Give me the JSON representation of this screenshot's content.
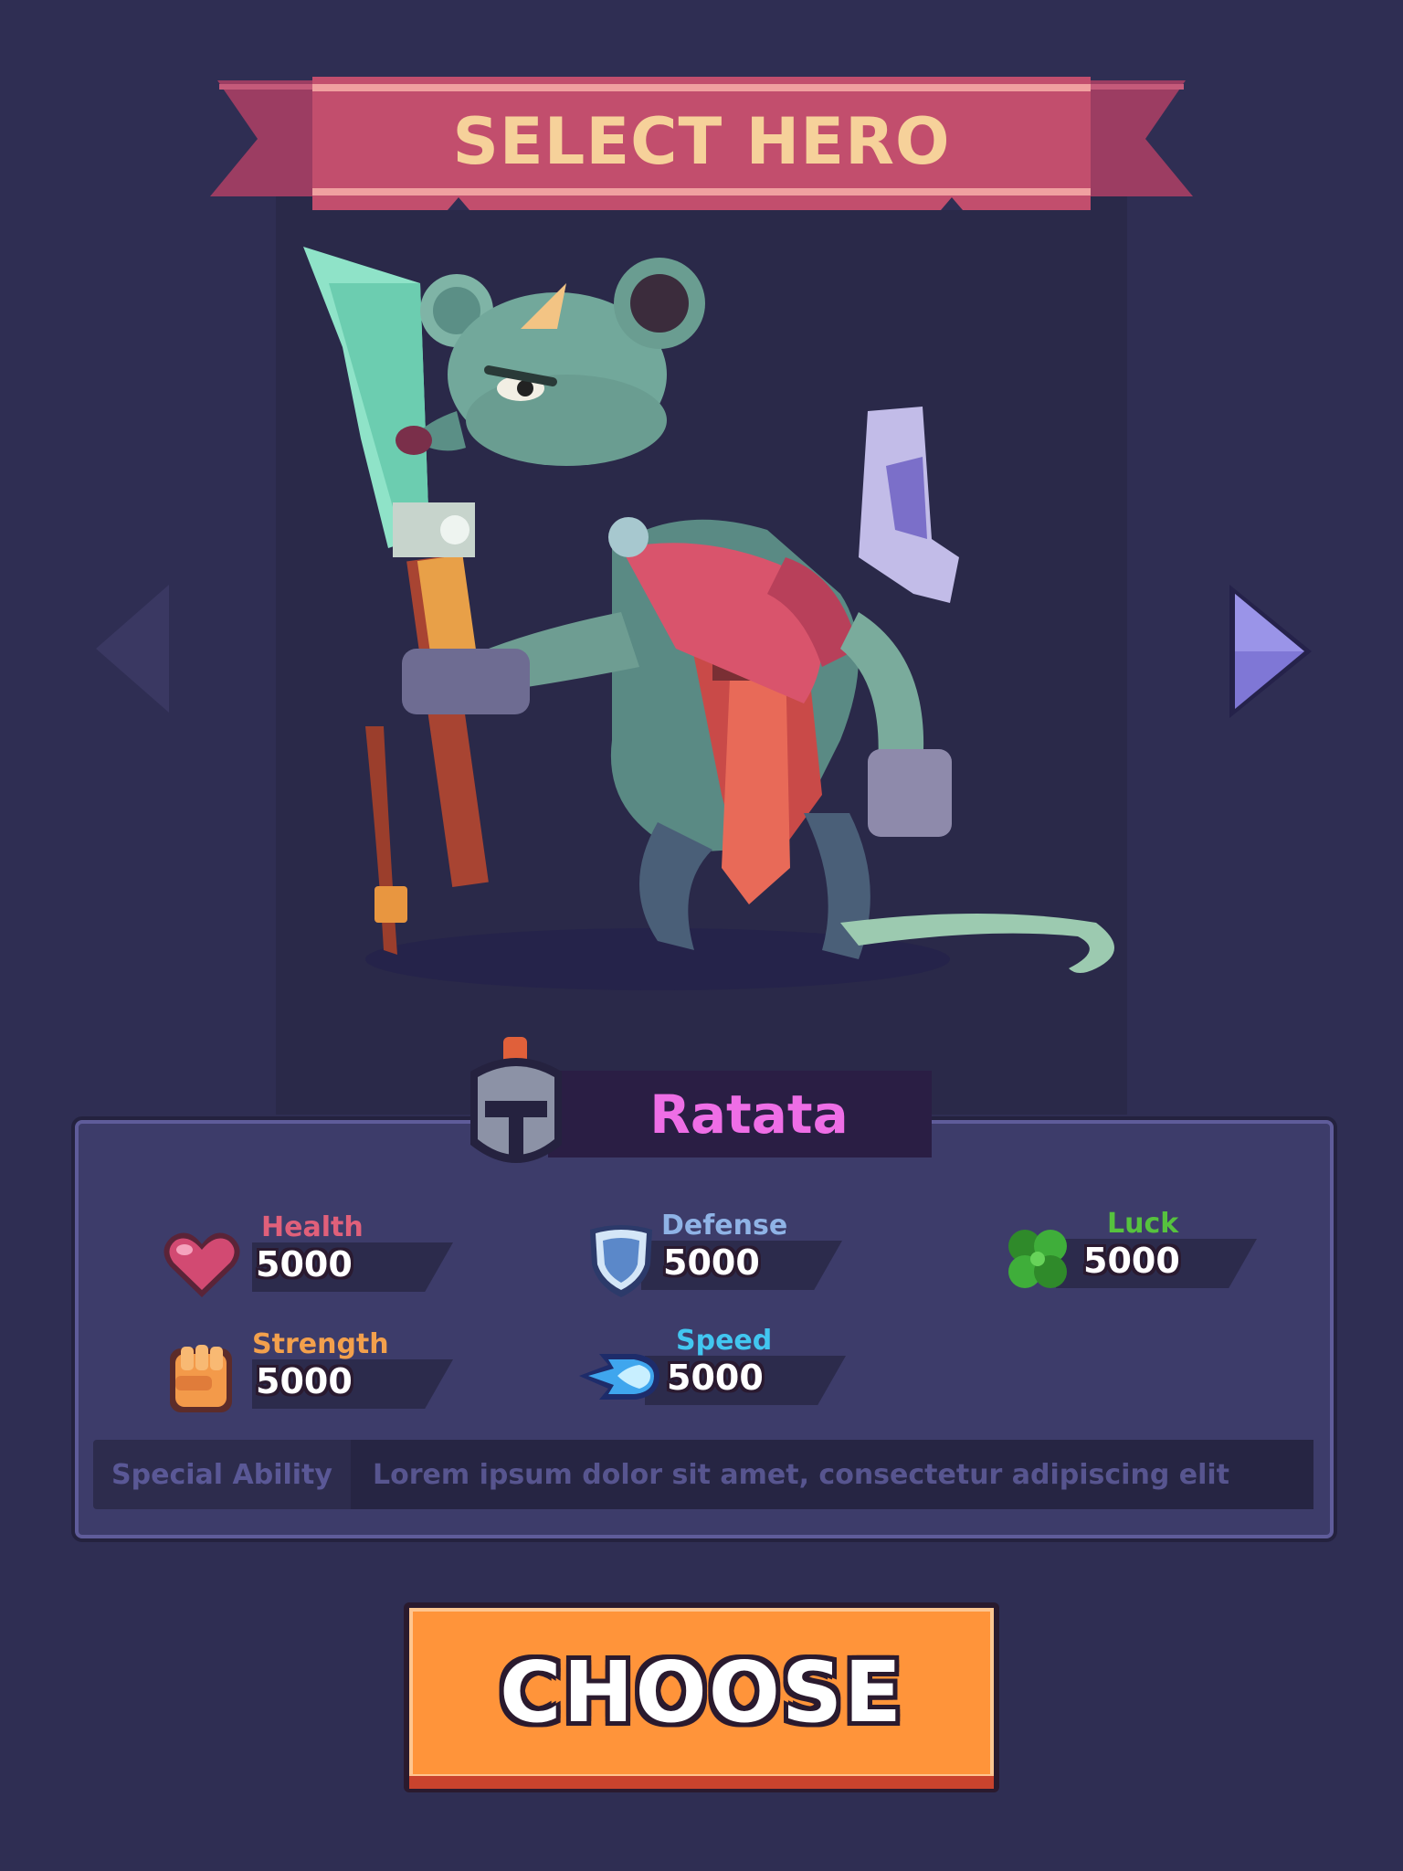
{
  "header": {
    "title": "SELECT HERO"
  },
  "hero": {
    "name": "Ratata"
  },
  "navigation": {
    "prev_icon": "triangle-left-icon",
    "next_icon": "triangle-right-icon"
  },
  "stats": [
    {
      "key": "health",
      "label": "Health",
      "value": "5000",
      "icon": "heart-icon",
      "label_color": "#e0607a"
    },
    {
      "key": "defense",
      "label": "Defense",
      "value": "5000",
      "icon": "shield-icon",
      "label_color": "#8fb3e6"
    },
    {
      "key": "luck",
      "label": "Luck",
      "value": "5000",
      "icon": "clover-icon",
      "label_color": "#56c23e"
    },
    {
      "key": "strength",
      "label": "Strength",
      "value": "5000",
      "icon": "fist-icon",
      "label_color": "#f3a04c"
    },
    {
      "key": "speed",
      "label": "Speed",
      "value": "5000",
      "icon": "speed-icon",
      "label_color": "#42c6f0"
    }
  ],
  "special_ability": {
    "label": "Special Ability",
    "text": "Lorem ipsum dolor sit amet, consectetur adipiscing elit"
  },
  "actions": {
    "choose_label": "CHOOSE"
  },
  "colors": {
    "background": "#2f2e53",
    "ribbon": "#c9506f",
    "ribbon_text": "#f6d19a",
    "name": "#ee6ee6",
    "button": "#ff943a"
  }
}
